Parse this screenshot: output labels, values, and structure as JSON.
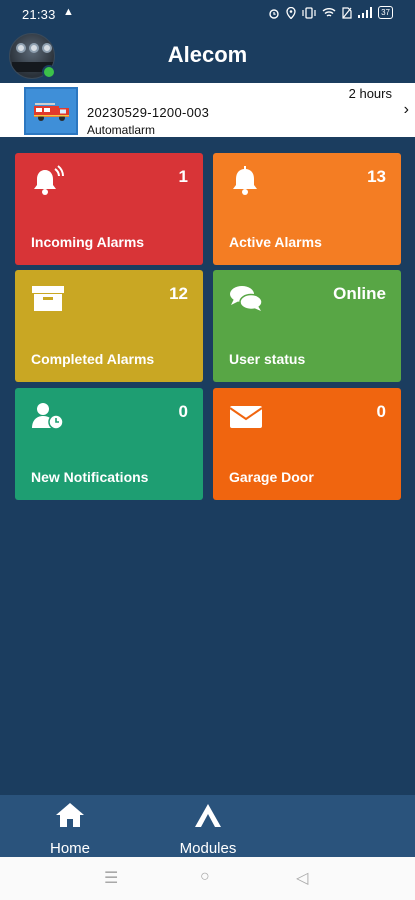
{
  "status_bar": {
    "time": "21:33",
    "upload_icon": "upload-arrow-icon",
    "icons": [
      "alarm-clock-icon",
      "location-icon",
      "vibrate-icon",
      "wifi-icon",
      "no-sim-icon",
      "signal-icon"
    ],
    "battery": "37"
  },
  "app_bar": {
    "title": "Alecom",
    "avatar": "user-avatar",
    "presence_color": "#3cc24a"
  },
  "latest_alarm": {
    "id": "20230529-1200-003",
    "type": "Automatlarm",
    "age": "2 hours",
    "thumbnail_icon": "fire-truck-icon"
  },
  "tiles": [
    {
      "label": "Incoming Alarms",
      "value": "1",
      "icon": "bell-ringing-icon",
      "color": "#d83437"
    },
    {
      "label": "Active Alarms",
      "value": "13",
      "icon": "bell-icon",
      "color": "#f47d23"
    },
    {
      "label": "Completed Alarms",
      "value": "12",
      "icon": "archive-box-icon",
      "color": "#c9a723"
    },
    {
      "label": "User status",
      "value": "Online",
      "icon": "chat-bubbles-icon",
      "color": "#58a645"
    },
    {
      "label": "New Notifications",
      "value": "0",
      "icon": "user-clock-icon",
      "color": "#1e9e72"
    },
    {
      "label": "Garage Door",
      "value": "0",
      "icon": "envelope-icon",
      "color": "#f0650f"
    }
  ],
  "bottom_nav": {
    "items": [
      {
        "label": "Home",
        "icon": "home-icon"
      },
      {
        "label": "Modules",
        "icon": "modules-icon"
      }
    ]
  },
  "system_nav": {
    "menu": "☰",
    "home": "○",
    "back": "◁"
  }
}
